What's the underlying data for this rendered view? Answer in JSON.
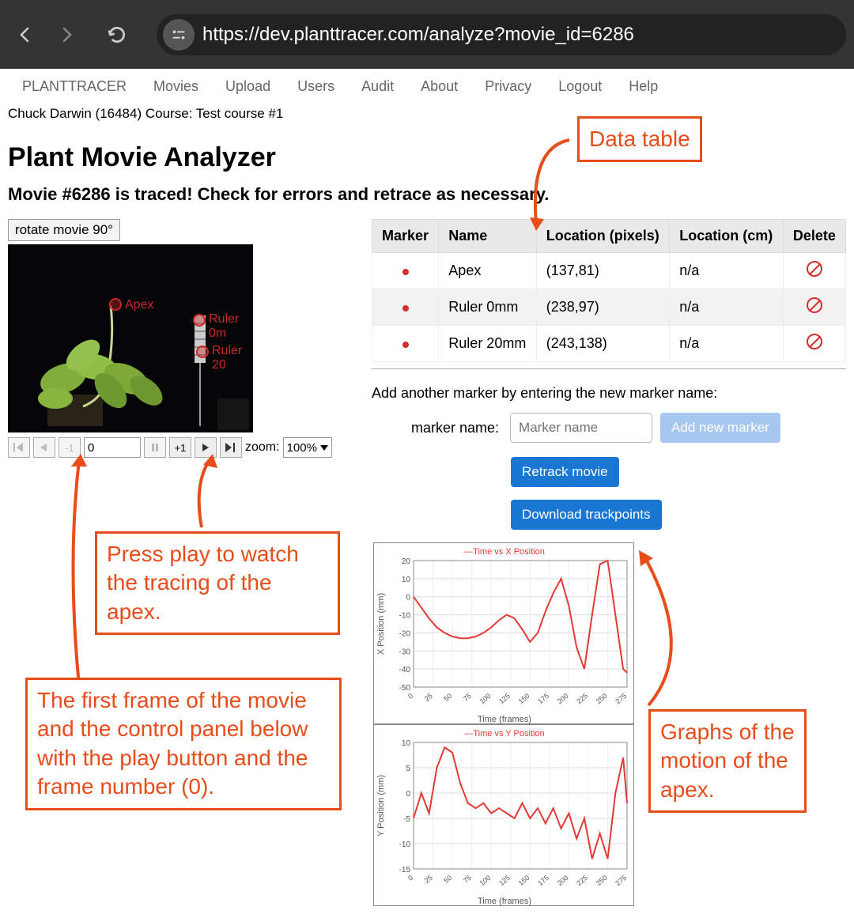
{
  "browser": {
    "url": "https://dev.planttracer.com/analyze?movie_id=6286"
  },
  "nav": {
    "items": [
      "PLANTTRACER",
      "Movies",
      "Upload",
      "Users",
      "Audit",
      "About",
      "Privacy",
      "Logout",
      "Help"
    ]
  },
  "user": {
    "info": "Chuck Darwin (16484) Course: Test course #1"
  },
  "page": {
    "title": "Plant Movie Analyzer",
    "subtitle": "Movie #6286 is traced! Check for errors and retrace as necessary."
  },
  "movie": {
    "rotate_label": "rotate movie 90°",
    "markers_overlay": [
      {
        "label": "Apex",
        "x": 140,
        "y": 78
      },
      {
        "label": "Ruler 0m",
        "x": 242,
        "y": 96
      },
      {
        "label": "Ruler 20",
        "x": 246,
        "y": 138
      }
    ]
  },
  "controls": {
    "back_to_start": "⏮",
    "back": "◀",
    "minus1": "-1",
    "frame_value": "0",
    "pause": "⏸",
    "plus1": "+1",
    "play": "▶",
    "to_end": "⏭",
    "zoom_label": "zoom:",
    "zoom_value": "100%"
  },
  "table": {
    "headers": [
      "Marker",
      "Name",
      "Location (pixels)",
      "Location (cm)",
      "Delete"
    ],
    "rows": [
      {
        "name": "Apex",
        "location_px": "(137,81)",
        "location_cm": "n/a"
      },
      {
        "name": "Ruler 0mm",
        "location_px": "(238,97)",
        "location_cm": "n/a"
      },
      {
        "name": "Ruler 20mm",
        "location_px": "(243,138)",
        "location_cm": "n/a"
      }
    ]
  },
  "form": {
    "add_text": "Add another marker by entering the new marker name:",
    "label": "marker name:",
    "placeholder": "Marker name",
    "add_btn": "Add new marker",
    "retrack_btn": "Retrack movie",
    "download_btn": "Download trackpoints"
  },
  "annotations": {
    "data_table": "Data table",
    "play": "Press play to watch the tracing of the apex.",
    "first_frame": "The first frame of the movie and the control panel below with the play button and the frame number (0).",
    "graphs": "Graphs of the motion of the apex."
  },
  "chart_data": [
    {
      "type": "line",
      "title": "Time vs X Position",
      "xlabel": "Time (frames)",
      "ylabel": "X Position (mm)",
      "xlim": [
        0,
        275
      ],
      "ylim": [
        -50,
        20
      ],
      "x_ticks": [
        0,
        25,
        50,
        75,
        100,
        125,
        150,
        175,
        200,
        225,
        250,
        275
      ],
      "y_ticks": [
        -50,
        -40,
        -30,
        -20,
        -10,
        0,
        10,
        20
      ],
      "x": [
        0,
        10,
        20,
        30,
        40,
        50,
        60,
        70,
        80,
        90,
        100,
        110,
        120,
        130,
        140,
        150,
        160,
        170,
        180,
        190,
        200,
        210,
        220,
        230,
        240,
        250,
        260,
        270,
        275
      ],
      "y": [
        0,
        -6,
        -12,
        -17,
        -20,
        -22,
        -23,
        -23,
        -22,
        -20,
        -17,
        -13,
        -10,
        -12,
        -18,
        -25,
        -20,
        -8,
        2,
        10,
        -5,
        -28,
        -40,
        -10,
        18,
        20,
        -10,
        -40,
        -42
      ],
      "series": [
        {
          "name": "Time vs X Position",
          "color": "#e53935"
        }
      ]
    },
    {
      "type": "line",
      "title": "Time vs Y Position",
      "xlabel": "Time (frames)",
      "ylabel": "Y Position (mm)",
      "xlim": [
        0,
        275
      ],
      "ylim": [
        -15,
        10
      ],
      "x_ticks": [
        0,
        25,
        50,
        75,
        100,
        125,
        150,
        175,
        200,
        225,
        250,
        275
      ],
      "y_ticks": [
        -15,
        -10,
        -5,
        0,
        5,
        10
      ],
      "x": [
        0,
        10,
        20,
        30,
        40,
        50,
        60,
        70,
        80,
        90,
        100,
        110,
        120,
        130,
        140,
        150,
        160,
        170,
        180,
        190,
        200,
        210,
        220,
        230,
        240,
        250,
        260,
        270,
        275
      ],
      "y": [
        -5,
        0,
        -4,
        5,
        9,
        8,
        2,
        -2,
        -3,
        -2,
        -4,
        -3,
        -4,
        -5,
        -2,
        -5,
        -3,
        -6,
        -3,
        -7,
        -4,
        -9,
        -5,
        -13,
        -8,
        -13,
        0,
        7,
        -2
      ],
      "series": [
        {
          "name": "Time vs Y Position",
          "color": "#e53935"
        }
      ]
    }
  ]
}
